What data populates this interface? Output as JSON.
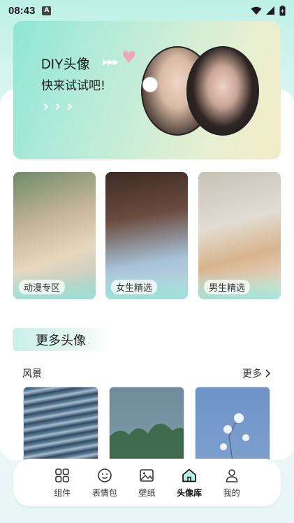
{
  "status_bar": {
    "time": "08:43",
    "app_badge": "A"
  },
  "banner": {
    "title": "DIY头像",
    "subtitle": "快来试试吧!",
    "arrows": "›››"
  },
  "categories": [
    {
      "label": "动漫专区"
    },
    {
      "label": "女生精选"
    },
    {
      "label": "男生精选"
    }
  ],
  "section": {
    "title": "更多头像"
  },
  "rows": [
    {
      "title": "风景",
      "more": "更多"
    }
  ],
  "nav": {
    "items": [
      {
        "label": "组件",
        "icon": "grid-icon"
      },
      {
        "label": "表情包",
        "icon": "smiley-icon"
      },
      {
        "label": "壁纸",
        "icon": "image-icon"
      },
      {
        "label": "头像库",
        "icon": "home-icon",
        "active": true
      },
      {
        "label": "我的",
        "icon": "user-icon"
      }
    ]
  },
  "colors": {
    "accent": "#16b89a",
    "banner_start": "#8fe6d5",
    "banner_end": "#f5ecc6"
  }
}
